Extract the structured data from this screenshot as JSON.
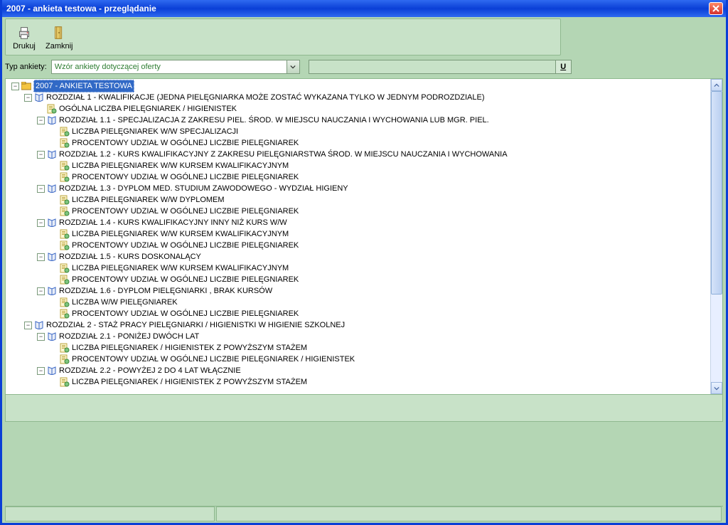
{
  "title": "2007 - ankieta testowa - przeglądanie",
  "toolbar": {
    "print_label": "Drukuj",
    "close_label": "Zamknij"
  },
  "type_row": {
    "label": "Typ ankiety:",
    "selected": "Wzór ankiety dotyczącej oferty",
    "u_button": "U"
  },
  "tree": [
    {
      "level": 0,
      "exp": "-",
      "icon": "folder",
      "selected": true,
      "text": "2007 - ANKIETA TESTOWA"
    },
    {
      "level": 1,
      "exp": "-",
      "icon": "book",
      "text": "ROZDZIAŁ 1 - KWALIFIKACJE (JEDNA PIELĘGNIARKA MOŻE ZOSTAĆ WYKAZANA TYLKO W JEDNYM PODROZDZIALE)"
    },
    {
      "level": 2,
      "exp": "",
      "icon": "leaf",
      "text": "OGÓLNA LICZBA PIELĘGNIAREK / HIGIENISTEK"
    },
    {
      "level": 2,
      "exp": "-",
      "icon": "book",
      "text": "ROZDZIAŁ 1.1 - SPECJALIZACJA Z ZAKRESU PIEL. ŚROD. W MIEJSCU NAUCZANIA I WYCHOWANIA LUB MGR. PIEL."
    },
    {
      "level": 3,
      "exp": "",
      "icon": "leaf",
      "text": "LICZBA PIELĘGNIAREK W/W SPECJALIZACJI"
    },
    {
      "level": 3,
      "exp": "",
      "icon": "leaf",
      "text": "PROCENTOWY UDZIAŁ W OGÓLNEJ LICZBIE PIELĘGNIAREK"
    },
    {
      "level": 2,
      "exp": "-",
      "icon": "book",
      "text": "ROZDZIAŁ 1.2 - KURS KWALIFIKACYJNY Z ZAKRESU PIELĘGNIARSTWA ŚROD. W MIEJSCU NAUCZANIA I WYCHOWANIA"
    },
    {
      "level": 3,
      "exp": "",
      "icon": "leaf",
      "text": "LICZBA PIELĘGNIAREK W/W KURSEM KWALIFIKACYJNYM"
    },
    {
      "level": 3,
      "exp": "",
      "icon": "leaf",
      "text": "PROCENTOWY UDZIAŁ W OGÓLNEJ LICZBIE PIELĘGNIAREK"
    },
    {
      "level": 2,
      "exp": "-",
      "icon": "book",
      "text": "ROZDZIAŁ 1.3 - DYPLOM MED. STUDIUM ZAWODOWEGO - WYDZIAŁ HIGIENY"
    },
    {
      "level": 3,
      "exp": "",
      "icon": "leaf",
      "text": "LICZBA PIELĘGNIAREK W/W DYPLOMEM"
    },
    {
      "level": 3,
      "exp": "",
      "icon": "leaf",
      "text": "PROCENTOWY UDZIAŁ W OGÓLNEJ LICZBIE PIELĘGNIAREK"
    },
    {
      "level": 2,
      "exp": "-",
      "icon": "book",
      "text": "ROZDZIAŁ 1.4 - KURS KWALIFIKACYJNY INNY NIŻ KURS W/W"
    },
    {
      "level": 3,
      "exp": "",
      "icon": "leaf",
      "text": "LICZBA PIELĘGNIAREK W/W KURSEM KWALIFIKACYJNYM"
    },
    {
      "level": 3,
      "exp": "",
      "icon": "leaf",
      "text": "PROCENTOWY UDZIAŁ W OGÓLNEJ LICZBIE PIELĘGNIAREK"
    },
    {
      "level": 2,
      "exp": "-",
      "icon": "book",
      "text": "ROZDZIAŁ 1.5 - KURS DOSKONALĄCY"
    },
    {
      "level": 3,
      "exp": "",
      "icon": "leaf",
      "text": "LICZBA PIELĘGNIAREK W/W KURSEM KWALIFIKACYJNYM"
    },
    {
      "level": 3,
      "exp": "",
      "icon": "leaf",
      "text": "PROCENTOWY UDZIAŁ W OGÓLNEJ LICZBIE PIELĘGNIAREK"
    },
    {
      "level": 2,
      "exp": "-",
      "icon": "book",
      "text": "ROZDZIAŁ 1.6 - DYPLOM PIELĘGNIARKI , BRAK KURSÓW"
    },
    {
      "level": 3,
      "exp": "",
      "icon": "leaf",
      "text": "LICZBA W/W PIELĘGNIAREK"
    },
    {
      "level": 3,
      "exp": "",
      "icon": "leaf",
      "text": "PROCENTOWY UDZIAŁ W OGÓLNEJ LICZBIE PIELĘGNIAREK"
    },
    {
      "level": 1,
      "exp": "-",
      "icon": "book",
      "text": "ROZDZIAŁ 2 - STAŻ PRACY PIELĘGNIARKI / HIGIENISTKI W HIGIENIE SZKOLNEJ"
    },
    {
      "level": 2,
      "exp": "-",
      "icon": "book",
      "text": "ROZDZIAŁ 2.1 - PONIŻEJ DWÓCH LAT"
    },
    {
      "level": 3,
      "exp": "",
      "icon": "leaf",
      "text": "LICZBA PIELĘGNIAREK / HIGIENISTEK Z POWYŻSZYM STAŻEM"
    },
    {
      "level": 3,
      "exp": "",
      "icon": "leaf",
      "text": "PROCENTOWY UDZIAŁ W OGÓLNEJ LICZBIE PIELĘGNIAREK / HIGIENISTEK"
    },
    {
      "level": 2,
      "exp": "-",
      "icon": "book",
      "text": "ROZDZIAŁ 2.2 - POWYŻEJ 2 DO 4 LAT WŁĄCZNIE"
    },
    {
      "level": 3,
      "exp": "",
      "icon": "leaf",
      "text": "LICZBA PIELĘGNIAREK / HIGIENISTEK Z POWYŻSZYM  STAŻEM"
    }
  ]
}
